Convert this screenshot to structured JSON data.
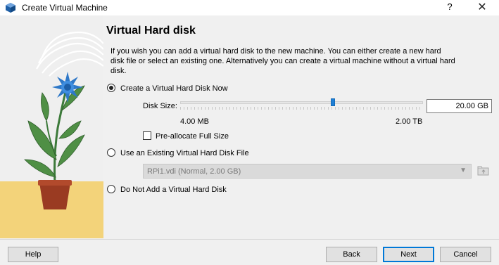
{
  "window": {
    "title": "Create Virtual Machine",
    "help_glyph": "?",
    "close_glyph": "✕"
  },
  "page": {
    "title": "Virtual Hard disk",
    "description": "If you wish you can add a virtual hard disk to the new machine. You can either create a new hard disk file or select an existing one. Alternatively you can create a virtual machine without a virtual hard disk."
  },
  "options": {
    "create": {
      "label": "Create a Virtual Hard Disk Now",
      "selected": true
    },
    "existing": {
      "label": "Use an Existing Virtual Hard Disk File",
      "selected": false
    },
    "none": {
      "label": "Do Not Add a Virtual Hard Disk",
      "selected": false
    }
  },
  "disk": {
    "size_label": "Disk Size:",
    "size_value": "20.00 GB",
    "min_label": "4.00 MB",
    "max_label": "2.00 TB",
    "slider_fraction": 0.63,
    "preallocate_label": "Pre-allocate Full Size",
    "preallocate_checked": false
  },
  "existing_file": {
    "selected": "RPi1.vdi (Normal, 2.00 GB)",
    "enabled": false
  },
  "buttons": {
    "help": "Help",
    "back": "Back",
    "next": "Next",
    "cancel": "Cancel"
  },
  "colors": {
    "accent": "#0078d7",
    "slider": "#1e7fd6",
    "flower": "#2e78c8"
  },
  "icons": {
    "app": "virtualbox-icon",
    "folder": "folder-icon",
    "combo": "chevron-down-icon"
  }
}
